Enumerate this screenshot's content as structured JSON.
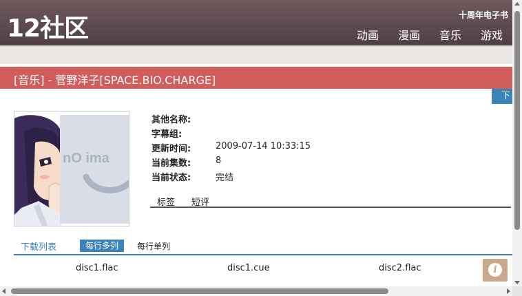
{
  "header": {
    "logo": "12社区",
    "tagline": "十周年电子书",
    "nav": [
      "动画",
      "漫画",
      "音乐",
      "游戏"
    ]
  },
  "title": "[音乐] - 菅野洋子[SPACE.BIO.CHARGE]",
  "download_tab": "下",
  "cover": {
    "placeholder_text": "nO ima"
  },
  "info": [
    {
      "label": "其他名称:",
      "value": ""
    },
    {
      "label": "字幕组:",
      "value": ""
    },
    {
      "label": "更新时间:",
      "value": "2009-07-14 10:33:15"
    },
    {
      "label": "当前集数:",
      "value": "8"
    },
    {
      "label": "当前状态:",
      "value": "完结"
    }
  ],
  "subtabs": [
    "标签",
    "短评"
  ],
  "download_list": {
    "title": "下载列表",
    "btn_multi": "每行多列",
    "btn_single": "每行单列",
    "files": [
      "disc1.flac",
      "disc1.cue",
      "disc2.flac"
    ]
  },
  "info_button": "i",
  "colors": {
    "header": "#5e4a4e",
    "titlebar": "#d15c5c",
    "accent": "#3b83b8",
    "info_button": "#c9a98a"
  }
}
